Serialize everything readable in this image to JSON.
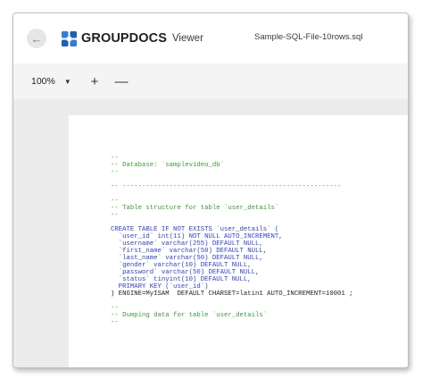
{
  "header": {
    "back_icon": "arrow-left-icon",
    "brand": "GROUPDOCS",
    "product": "Viewer",
    "file_name": "Sample-SQL-File-10rows.sql"
  },
  "toolbar": {
    "zoom_value": "100%",
    "zoom_in_label": "+",
    "zoom_out_label": "—"
  },
  "document": {
    "lines": [
      {
        "text": "--",
        "kind": "comment"
      },
      {
        "text": "-- Database: `samplevideo_db`",
        "kind": "comment"
      },
      {
        "text": "--",
        "kind": "comment"
      },
      {
        "text": "",
        "kind": "blank"
      },
      {
        "text": "-- --------------------------------------------------------",
        "kind": "comment"
      },
      {
        "text": "",
        "kind": "blank"
      },
      {
        "text": "--",
        "kind": "comment"
      },
      {
        "text": "-- Table structure for table `user_details`",
        "kind": "comment"
      },
      {
        "text": "--",
        "kind": "comment"
      },
      {
        "text": "",
        "kind": "blank"
      },
      {
        "text": "CREATE TABLE IF NOT EXISTS `user_details` (",
        "kind": "code"
      },
      {
        "text": "  `user_id` int(11) NOT NULL AUTO_INCREMENT,",
        "kind": "code"
      },
      {
        "text": "  `username` varchar(255) DEFAULT NULL,",
        "kind": "code"
      },
      {
        "text": "  `first_name` varchar(50) DEFAULT NULL,",
        "kind": "code"
      },
      {
        "text": "  `last_name` varchar(50) DEFAULT NULL,",
        "kind": "code"
      },
      {
        "text": "  `gender` varchar(10) DEFAULT NULL,",
        "kind": "code"
      },
      {
        "text": "  `password` varchar(50) DEFAULT NULL,",
        "kind": "code"
      },
      {
        "text": "  `status` tinyint(10) DEFAULT NULL,",
        "kind": "code"
      },
      {
        "text": "  PRIMARY KEY (`user_id`)",
        "kind": "code"
      },
      {
        "text": ") ENGINE=MyISAM  DEFAULT CHARSET=latin1 AUTO_INCREMENT=10001 ;",
        "kind": "code-dark"
      },
      {
        "text": "",
        "kind": "blank"
      },
      {
        "text": "--",
        "kind": "comment"
      },
      {
        "text": "-- Dumping data for table `user_details`",
        "kind": "comment"
      },
      {
        "text": "--",
        "kind": "comment"
      }
    ]
  },
  "colors": {
    "comment": "#3f9a35",
    "keyword": "#2b3fd6",
    "identifier": "#555555",
    "toolbar_bg": "#f4f4f4",
    "viewport_bg": "#ececec"
  }
}
